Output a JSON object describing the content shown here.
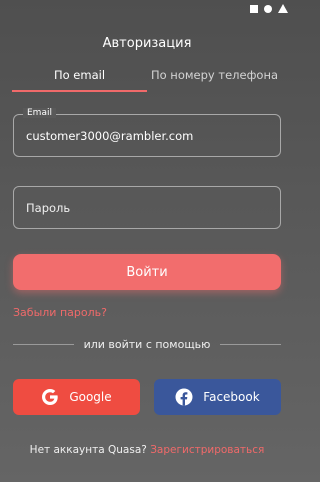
{
  "title": "Авторизация",
  "tabs": [
    {
      "label": "По email",
      "active": true
    },
    {
      "label": "По номеру телефона",
      "active": false
    }
  ],
  "email_field": {
    "label": "Email",
    "value": "customer3000@rambler.com"
  },
  "password_field": {
    "placeholder": "Пароль",
    "value": ""
  },
  "login_button": "Войти",
  "forgot_password": "Забыли пароль?",
  "divider_text": "или войти с помощью",
  "social": {
    "google": "Google",
    "facebook": "Facebook"
  },
  "footer": {
    "text": "Нет аккаунта Quasa?",
    "link": "Зарегистрироваться"
  },
  "colors": {
    "accent": "#f26d6d",
    "google": "#ef4c41",
    "facebook": "#3a579b"
  }
}
